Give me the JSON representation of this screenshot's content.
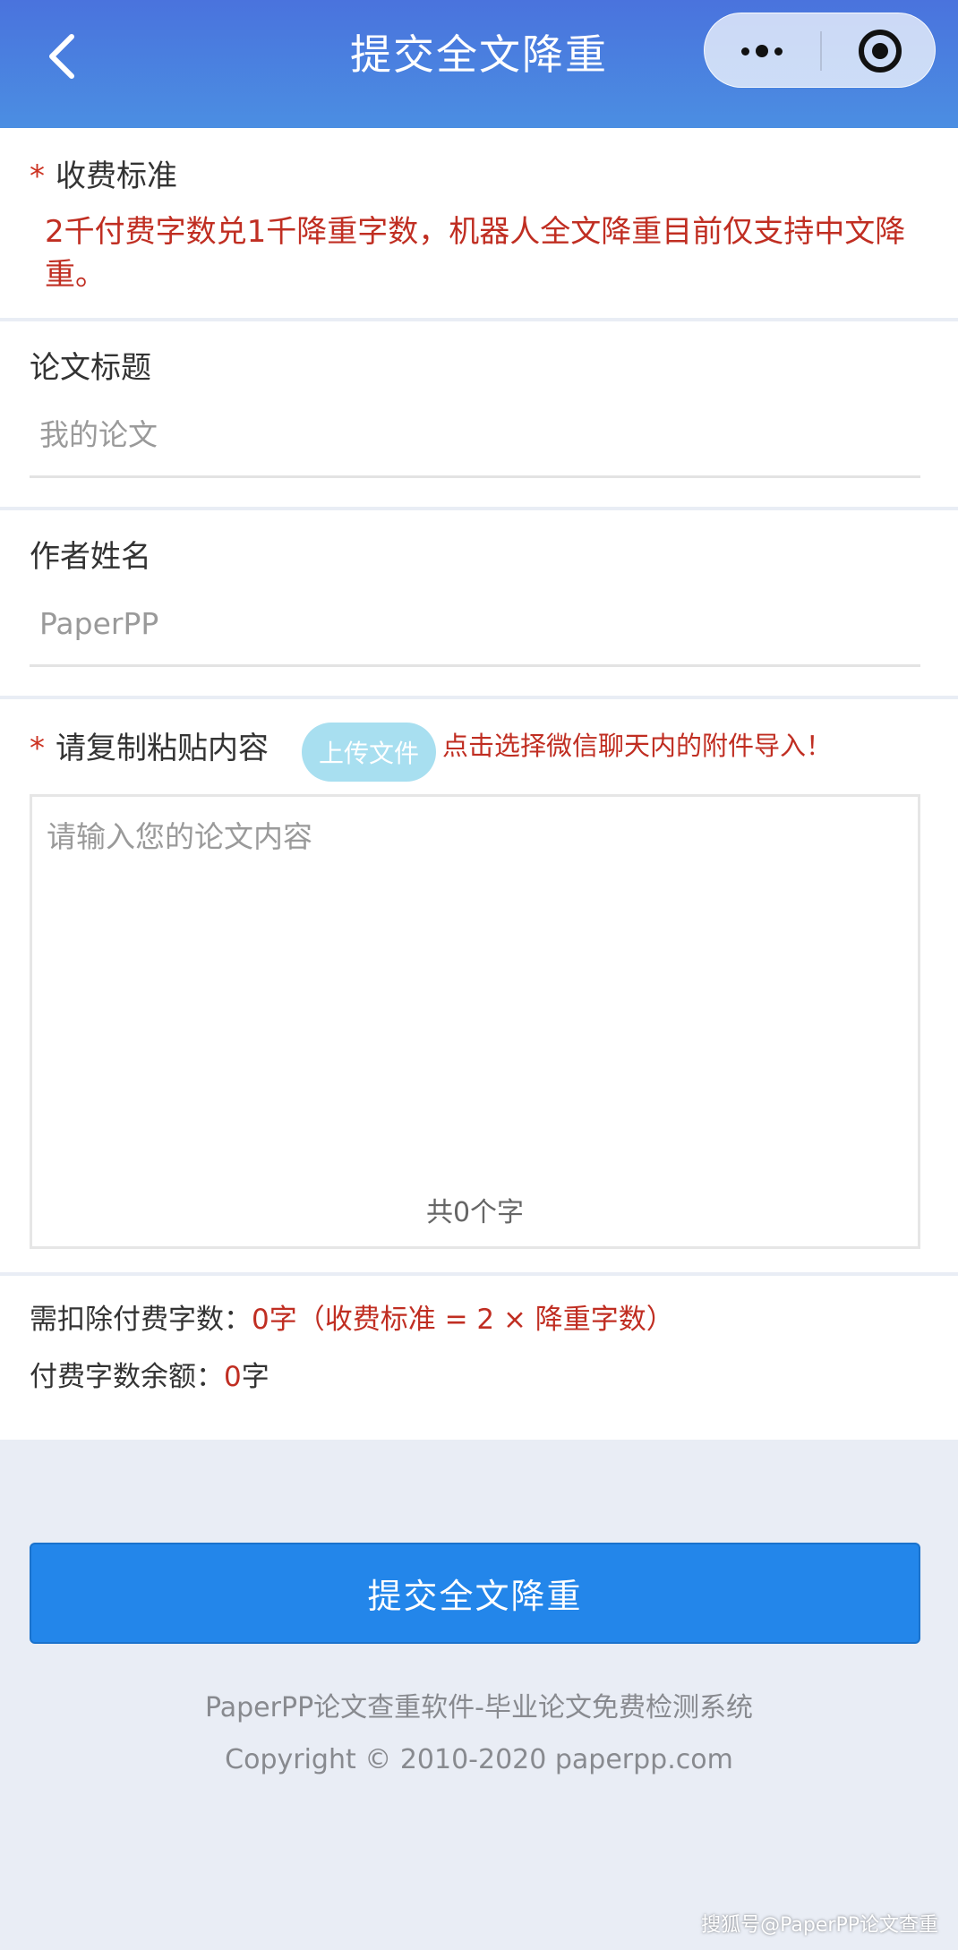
{
  "header": {
    "title": "提交全文降重",
    "back_icon": "chevron-left-icon",
    "more_icon": "more-dots-icon",
    "close_icon": "target-circle-icon"
  },
  "fee": {
    "label": "收费标准",
    "required_mark": "*",
    "text": "2千付费字数兑1千降重字数，机器人全文降重目前仅支持中文降重。"
  },
  "title_field": {
    "label": "论文标题",
    "placeholder": "我的论文",
    "value": ""
  },
  "author_field": {
    "label": "作者姓名",
    "placeholder": "PaperPP",
    "value": ""
  },
  "content_field": {
    "required_mark": "*",
    "label": "请复制粘贴内容",
    "upload_button": "上传文件",
    "upload_hint": "点击选择微信聊天内的附件导入！",
    "placeholder": "请输入您的论文内容",
    "value": "",
    "count_prefix": "共",
    "count_value": "0",
    "count_suffix": "个字"
  },
  "summary": {
    "deduct_label": "需扣除付费字数：",
    "deduct_value": "0字（收费标准 = 2 × 降重字数）",
    "balance_label": "付费字数余额：",
    "balance_value": "0",
    "balance_unit": "字"
  },
  "submit": {
    "label": "提交全文降重"
  },
  "footer": {
    "line1": "PaperPP论文查重软件-毕业论文免费检测系统",
    "line2": "Copyright © 2010-2020 paperpp.com"
  },
  "watermark": "搜狐号@PaperPP论文查重",
  "colors": {
    "header_start": "#4a73dd",
    "header_end": "#4b8ee2",
    "accent_red": "#c02e22",
    "submit_blue": "#2386ea",
    "upload_button": "#a8dff0",
    "page_bg": "#e9edf5"
  }
}
